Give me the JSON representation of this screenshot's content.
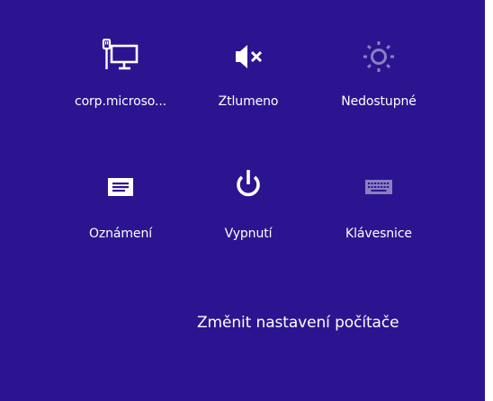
{
  "colors": {
    "panel_background": "#2c1491",
    "icon_active": "#ffffff",
    "icon_disabled": "#8a80c0"
  },
  "tiles": [
    {
      "label": "corp.microso...",
      "icon": "network-wired-icon"
    },
    {
      "label": "Ztlumeno",
      "icon": "volume-muted-icon"
    },
    {
      "label": "Nedostupné",
      "icon": "brightness-icon"
    },
    {
      "label": "Oznámení",
      "icon": "notifications-icon"
    },
    {
      "label": "Vypnutí",
      "icon": "power-icon"
    },
    {
      "label": "Klávesnice",
      "icon": "keyboard-icon"
    }
  ],
  "footer": {
    "change_settings_label": "Změnit nastavení počítače"
  }
}
